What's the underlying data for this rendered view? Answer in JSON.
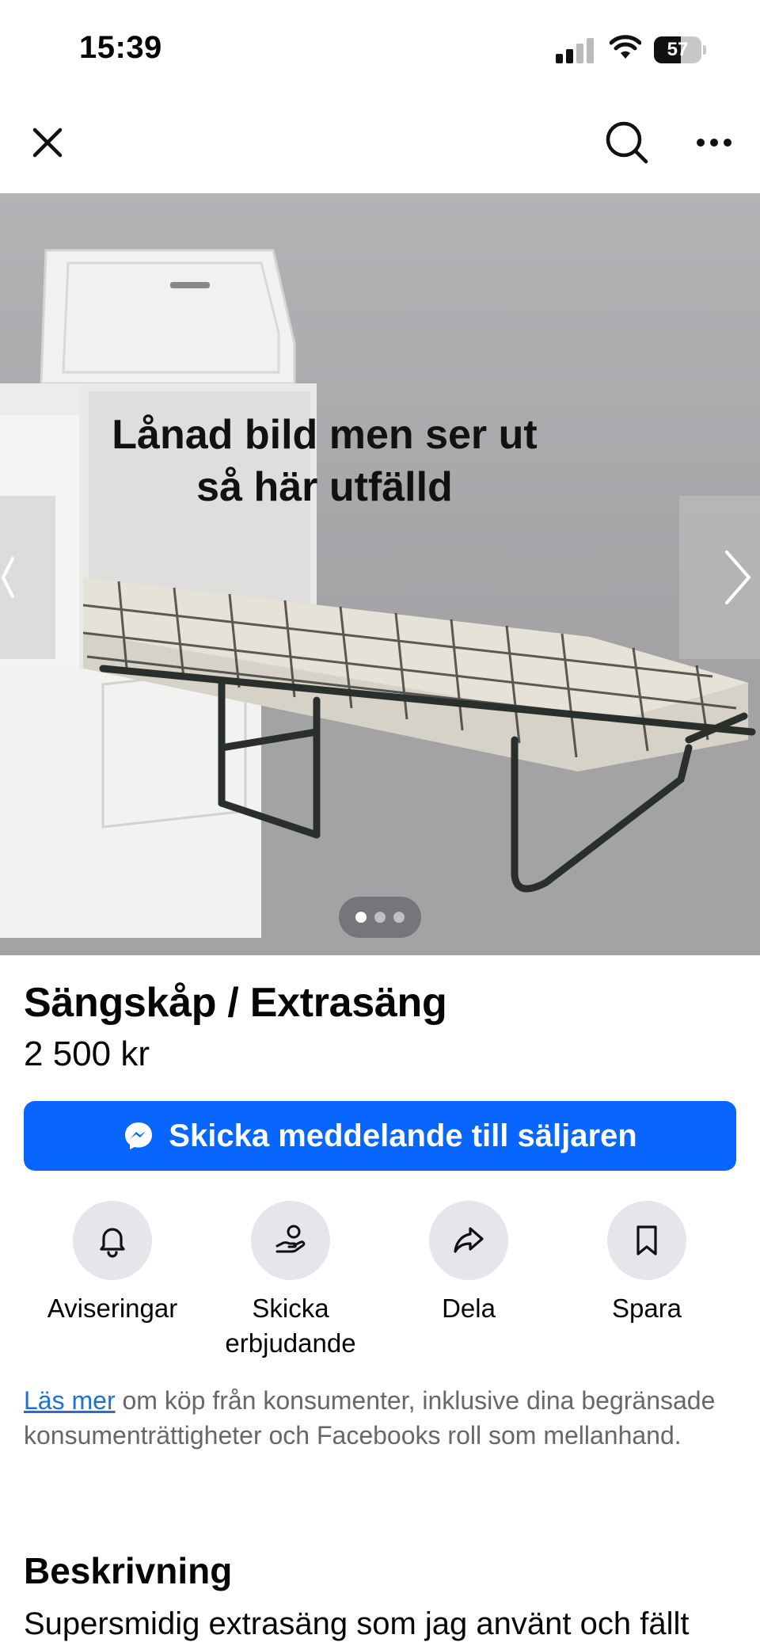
{
  "status_bar": {
    "time": "15:39",
    "battery": "57",
    "battery_level": 0.57,
    "icons": [
      "cellular-signal-icon",
      "wifi-icon",
      "battery-icon"
    ]
  },
  "top_nav": {
    "icons": [
      "close-icon",
      "search-icon",
      "more-options-icon"
    ]
  },
  "carousel": {
    "caption_line1": "Lånad bild men ser ut",
    "caption_line2": "så här utfälld",
    "image_count": 3,
    "active_index": 0,
    "icons": [
      "chevron-left-icon",
      "chevron-right-icon"
    ]
  },
  "listing": {
    "title": "Sängskåp / Extrasäng",
    "price": "2 500 kr"
  },
  "message_button": {
    "label": "Skicka meddelande till säljaren",
    "icon": "messenger-icon",
    "color": "#0866ff"
  },
  "actions": [
    {
      "label": "Aviseringar",
      "icon": "bell-icon"
    },
    {
      "label": "Skicka erbjudande",
      "icon": "offer-hand-icon"
    },
    {
      "label": "Dela",
      "icon": "share-icon"
    },
    {
      "label": "Spara",
      "icon": "bookmark-icon"
    }
  ],
  "disclaimer": {
    "link": "Läs mer",
    "text": " om köp från konsumenter, inklusive dina begränsade konsumenträttigheter och Facebooks roll som mellanhand."
  },
  "description": {
    "heading": "Beskrivning",
    "text": "Supersmidig extrasäng som jag använt och fällt"
  }
}
